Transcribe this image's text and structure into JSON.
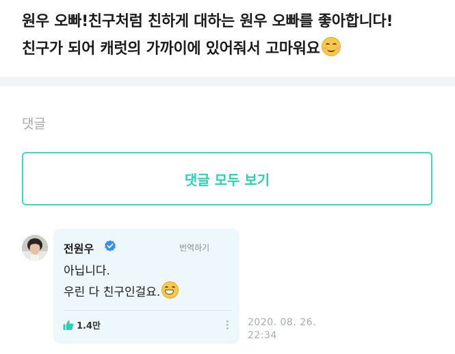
{
  "post": {
    "line1": "원우 오빠!친구처럼 친하게 대하는 원우 오빠를 좋아합니다!",
    "line2": "친구가 되어 캐럿의 가까이에 있어줘서 고마워요"
  },
  "comments_section": {
    "title": "댓글",
    "view_all_label": "댓글 모두 보기"
  },
  "comment": {
    "author": "전원우",
    "translate_label": "번역하기",
    "body_line1": "아닙니다.",
    "body_line2": "우린 다 친구인걸요.",
    "like_count": "1.4만",
    "date": "2020. 08. 26.",
    "time": "22:34"
  },
  "colors": {
    "accent": "#2ccfb3",
    "verified": "#3b8ef0",
    "bubble_bg": "#eef7fc",
    "like_icon": "#2ccfb3"
  },
  "icons": {
    "post_emoji": "smiling-face-emoji",
    "comment_emoji": "grinning-face-emoji",
    "verified": "verified-badge-icon",
    "like": "thumbs-up-icon",
    "more": "more-vertical-icon"
  }
}
